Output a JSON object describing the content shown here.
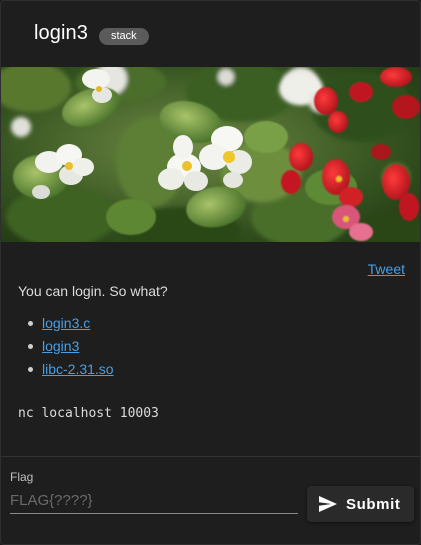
{
  "header": {
    "title": "login3",
    "badge": "stack"
  },
  "banner": {
    "image": "flowers-photo"
  },
  "tweet_link": "Tweet",
  "description": "You can login. So what?",
  "files": [
    {
      "label": "login3.c"
    },
    {
      "label": "login3"
    },
    {
      "label": "libc-2.31.so"
    }
  ],
  "connection": "nc localhost 10003",
  "form": {
    "label": "Flag",
    "placeholder": "FLAG{????}",
    "value": "",
    "submit_label": "Submit",
    "submit_icon": "send-icon"
  },
  "colors": {
    "background": "#1e1e1e",
    "link": "#4a9fe4",
    "badge": "#5b5b5b"
  }
}
